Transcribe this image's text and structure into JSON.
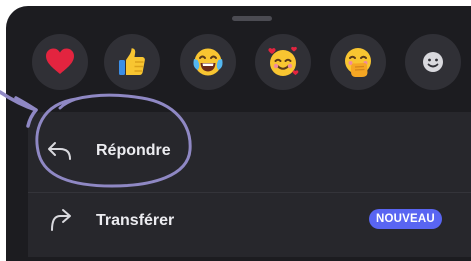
{
  "reactions": [
    {
      "icon": "heart-emoji"
    },
    {
      "icon": "thumbs-up-emoji"
    },
    {
      "icon": "tears-of-joy-emoji"
    },
    {
      "icon": "smiling-face-with-hearts-emoji"
    },
    {
      "icon": "face-with-hand-over-mouth-emoji"
    },
    {
      "icon": "add-reaction-smiley-icon"
    }
  ],
  "menu": {
    "reply": {
      "label": "Répondre",
      "icon": "reply-arrow-icon"
    },
    "forward": {
      "label": "Transférer",
      "icon": "forward-arrow-icon",
      "badge": "NOUVEAU"
    }
  },
  "colors": {
    "sheet_bg": "#1c1c20",
    "panel_bg": "#27272c",
    "badge_bg": "#5965f2",
    "annotation": "#8f88c4"
  }
}
